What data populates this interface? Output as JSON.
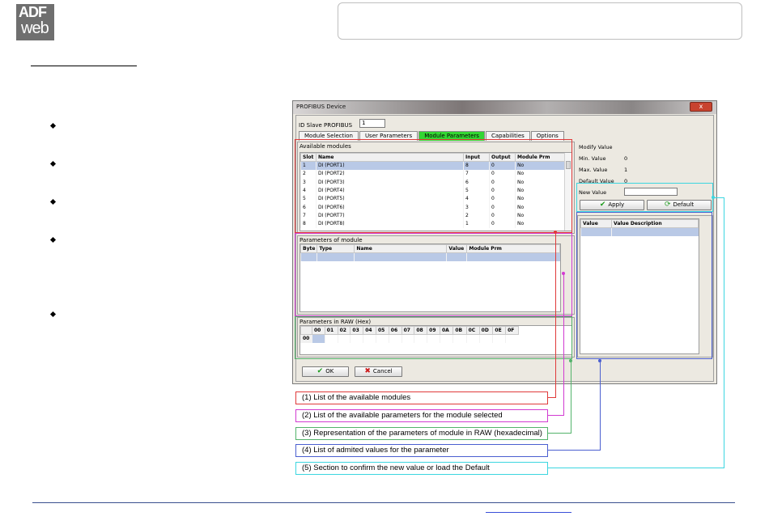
{
  "logo": {
    "line1": "ADF",
    "line2": "web"
  },
  "dialog": {
    "title": "PROFIBUS Device",
    "close_label": "x",
    "id_slave_label": "ID Slave PROFIBUS",
    "id_slave_value": "1",
    "tabs": [
      "Module Selection",
      "User Parameters",
      "Module Parameters",
      "Capabilities",
      "Options"
    ],
    "active_tab": "Module Parameters",
    "available_modules": {
      "title": "Available modules",
      "columns": [
        "Slot",
        "Name",
        "Input",
        "Output",
        "Module Prm"
      ],
      "rows": [
        [
          "1",
          "DI (PORT1)",
          "8",
          "0",
          "No"
        ],
        [
          "2",
          "DI (PORT2)",
          "7",
          "0",
          "No"
        ],
        [
          "3",
          "DI (PORT3)",
          "6",
          "0",
          "No"
        ],
        [
          "4",
          "DI (PORT4)",
          "5",
          "0",
          "No"
        ],
        [
          "5",
          "DI (PORT5)",
          "4",
          "0",
          "No"
        ],
        [
          "6",
          "DI (PORT6)",
          "3",
          "0",
          "No"
        ],
        [
          "7",
          "DI (PORT7)",
          "2",
          "0",
          "No"
        ],
        [
          "8",
          "DI (PORT8)",
          "1",
          "0",
          "No"
        ]
      ]
    },
    "parameters_of_module": {
      "title": "Parameters of module",
      "columns": [
        "Byte",
        "Type",
        "Name",
        "Value",
        "Module Prm"
      ]
    },
    "parameters_raw": {
      "title": "Parameters in RAW (Hex)",
      "columns": [
        "00",
        "01",
        "02",
        "03",
        "04",
        "05",
        "06",
        "07",
        "08",
        "09",
        "0A",
        "0B",
        "0C",
        "0D",
        "0E",
        "0F"
      ],
      "row_label": "00"
    },
    "modify_value": {
      "title": "Modify Value",
      "min_label": "Min. Value",
      "min_value": "0",
      "max_label": "Max. Value",
      "max_value": "1",
      "default_label": "Default Value",
      "default_value": "0",
      "new_value_label": "New Value",
      "apply_label": "Apply",
      "default_button_label": "Default"
    },
    "values_table": {
      "columns": [
        "Value",
        "Value Description"
      ]
    },
    "ok_label": "OK",
    "cancel_label": "Cancel"
  },
  "captions": [
    {
      "text": "(1) List of the available modules",
      "color": "#e03a3a"
    },
    {
      "text": "(2) List of the available parameters for the module selected",
      "color": "#d23bd2"
    },
    {
      "text": "(3) Representation of the parameters of module in RAW (hexadecimal)",
      "color": "#53b36b"
    },
    {
      "text": "(4) List of admited values for the parameter",
      "color": "#4b5fd0"
    },
    {
      "text": "(5) Section to confirm the new value or load the Default",
      "color": "#3cd6e0"
    }
  ]
}
